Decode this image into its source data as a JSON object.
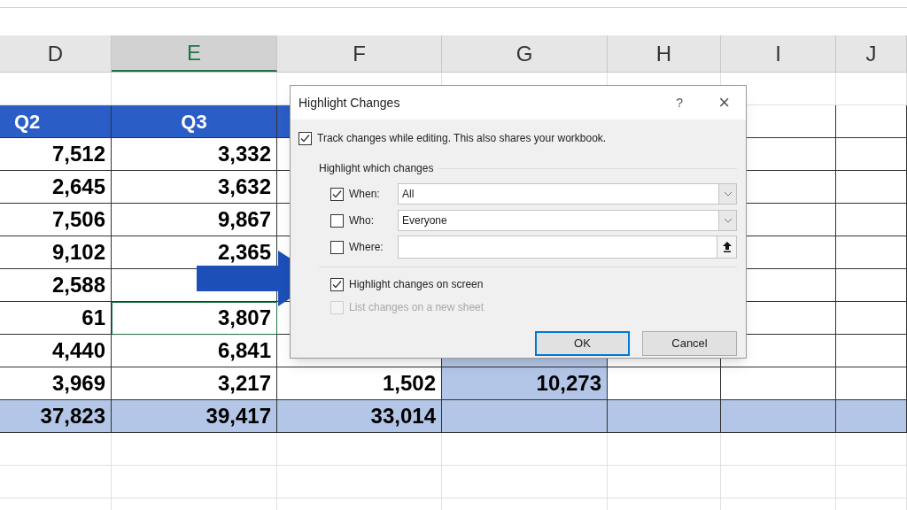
{
  "sheet": {
    "columns": [
      {
        "label": "D",
        "selected": false
      },
      {
        "label": "E",
        "selected": true
      },
      {
        "label": "F",
        "selected": false
      },
      {
        "label": "G",
        "selected": false
      },
      {
        "label": "H",
        "selected": false
      },
      {
        "label": "I",
        "selected": false
      },
      {
        "label": "J",
        "selected": false
      }
    ],
    "rows": [
      {
        "kind": "blank",
        "cells": []
      },
      {
        "kind": "header",
        "cells": [
          {
            "text": "Q2"
          },
          {
            "text": "Q3"
          },
          {},
          {}
        ]
      },
      {
        "kind": "data",
        "cells": [
          {
            "text": "7,512"
          },
          {
            "text": "3,332"
          }
        ]
      },
      {
        "kind": "data",
        "cells": [
          {
            "text": "2,645"
          },
          {
            "text": "3,632"
          }
        ]
      },
      {
        "kind": "data",
        "cells": [
          {
            "text": "7,506"
          },
          {
            "text": "9,867"
          }
        ]
      },
      {
        "kind": "data",
        "cells": [
          {
            "text": "9,102"
          },
          {
            "text": "2,365"
          }
        ]
      },
      {
        "kind": "data",
        "cells": [
          {
            "text": "2,588"
          },
          {}
        ]
      },
      {
        "kind": "data",
        "cells": [
          {
            "text": "61"
          },
          {
            "text": "3,807",
            "selected": true
          }
        ]
      },
      {
        "kind": "data",
        "cells": [
          {
            "text": "4,440"
          },
          {
            "text": "6,841"
          },
          {},
          {
            "shaded": true
          }
        ]
      },
      {
        "kind": "data",
        "cells": [
          {
            "text": "3,969"
          },
          {
            "text": "3,217"
          },
          {
            "text": "1,502"
          },
          {
            "text": "10,273",
            "shaded": true
          }
        ]
      },
      {
        "kind": "total",
        "cells": [
          {
            "text": "37,823"
          },
          {
            "text": "39,417"
          },
          {
            "text": "33,014"
          },
          {}
        ]
      },
      {
        "kind": "blank",
        "cells": []
      },
      {
        "kind": "blank",
        "cells": []
      },
      {
        "kind": "blank",
        "cells": []
      }
    ]
  },
  "dialog": {
    "title": "Highlight Changes",
    "help": "?",
    "close": "×",
    "track": {
      "label": "Track changes while editing. This also shares your workbook.",
      "checked": true
    },
    "group_title": "Highlight which changes",
    "filters": [
      {
        "label": "When:",
        "checked": true,
        "kind": "dropdown",
        "value": "All"
      },
      {
        "label": "Who:",
        "checked": false,
        "kind": "dropdown",
        "value": "Everyone"
      },
      {
        "label": "Where:",
        "checked": false,
        "kind": "range"
      }
    ],
    "options": [
      {
        "label": "Highlight changes on screen",
        "checked": true,
        "disabled": false
      },
      {
        "label": "List changes on a new sheet",
        "checked": false,
        "disabled": true
      }
    ],
    "buttons": [
      {
        "label": "OK",
        "selected": true
      },
      {
        "label": "Cancel",
        "selected": false
      }
    ]
  }
}
